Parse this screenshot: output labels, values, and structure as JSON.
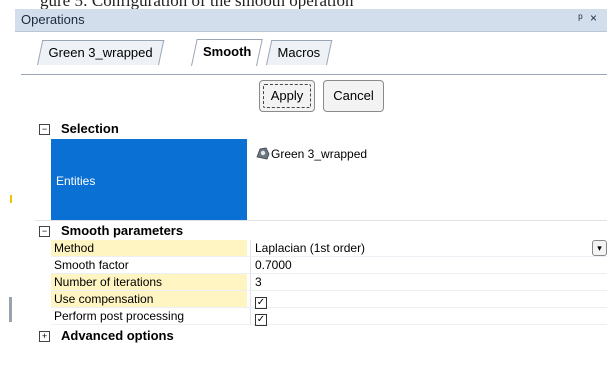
{
  "top_clip": "gure 5: Configuration of the smooth operation",
  "panel": {
    "title": "Operations",
    "pin_icon": "pin-icon",
    "close_icon": "close-icon"
  },
  "tabs": [
    {
      "label": "Green 3_wrapped",
      "active": false
    },
    {
      "label": "Smooth",
      "active": true
    },
    {
      "label": "Macros",
      "active": false
    }
  ],
  "buttons": {
    "apply": "Apply",
    "cancel": "Cancel"
  },
  "sections": {
    "selection": {
      "label": "Selection",
      "toggle": "−",
      "entities_label": "Entities",
      "entity_value": "Green 3_wrapped",
      "entity_icon": "mesh-object-icon"
    },
    "smooth_parameters": {
      "label": "Smooth parameters",
      "toggle": "−",
      "rows": [
        {
          "name": "Method",
          "value": "Laplacian (1st order)"
        },
        {
          "name": "Smooth factor",
          "value": "0.7000"
        },
        {
          "name": "Number of iterations",
          "value": "3"
        },
        {
          "name": "Use compensation",
          "value": "✓"
        },
        {
          "name": "Perform post processing",
          "value": "✓"
        }
      ]
    },
    "advanced": {
      "label": "Advanced options",
      "toggle": "+"
    }
  },
  "colors": {
    "titlebar": "#d3deec",
    "selected": "#0b70d4",
    "highlight": "#fff5c2"
  }
}
